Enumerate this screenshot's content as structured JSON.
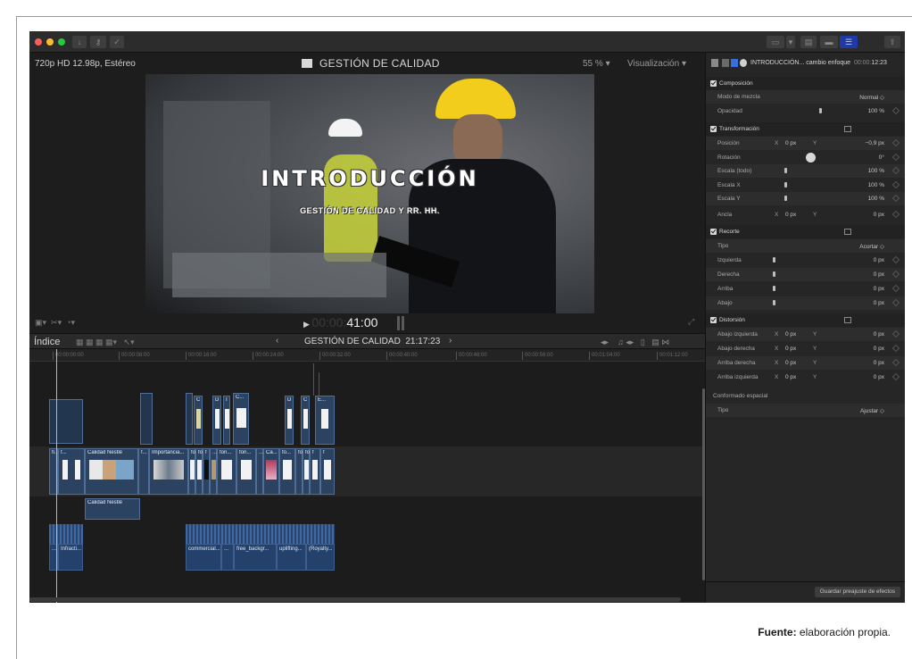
{
  "titlebar": {
    "icons": [
      "close-dot",
      "minimize-dot",
      "maximize-dot",
      "download-icon",
      "key-icon",
      "check-icon"
    ],
    "colors": {
      "close": "#ff5f57",
      "minimize": "#febc2e",
      "maximize": "#28c840"
    }
  },
  "viewer": {
    "format": "720p HD 12.98p, Estéreo",
    "title": "GESTIÓN DE CALIDAD",
    "zoom": "55 %",
    "view_menu": "Visualización",
    "video_title": "INTRODUCCIÓN",
    "video_subtitle": "GESTIÓN DE CALIDAD Y RR. HH.",
    "timecode_dim": "00:00:",
    "timecode": "41:00"
  },
  "timeline": {
    "index_label": "Índice",
    "project_title": "GESTIÓN DE CALIDAD",
    "project_duration": "21:17:23",
    "ruler_ticks": [
      "00:00:00:00",
      "00:00:08:00",
      "00:00:16:00",
      "00:00:24:00",
      "00:00:32:00",
      "00:00:40:00",
      "00:00:48:00",
      "00:00:56:00",
      "00:01:04:00",
      "00:01:12:00"
    ],
    "upper_clips": [
      "C",
      "D",
      "I",
      "C...",
      "D",
      "C",
      "E..."
    ],
    "story_clips": [
      "fi...",
      "f...",
      "Calidad Nestlé",
      "f...",
      "Importancia...",
      "fo",
      "fo",
      "f",
      "...",
      "fon...",
      "fon...",
      "...",
      "Ca...",
      "fo...",
      "fo",
      "fo",
      "f",
      "f"
    ],
    "connected_clip": "Calidad Nestlé",
    "audio_clips": [
      "...",
      "Infracti...",
      "commercial...",
      "...",
      "free_backgr...",
      "uplifting...",
      "(Royalty..."
    ]
  },
  "inspector": {
    "clip_name": "INTRODUCCIÓN... cambio enfoque",
    "clip_tc_dim": "00:00:",
    "clip_tc": "12:23",
    "sections": {
      "composicion": "Composición",
      "transformacion": "Transformación",
      "recorte": "Recorte",
      "distorsion": "Distorsión"
    },
    "rows": {
      "modo_mezcla": {
        "label": "Modo de mezcla",
        "value": "Normal ◇"
      },
      "opacidad": {
        "label": "Opacidad",
        "value": "100 %"
      },
      "posicion": {
        "label": "Posición",
        "x_label": "X",
        "x": "0 px",
        "y_label": "Y",
        "y": "−0,9 px"
      },
      "rotacion": {
        "label": "Rotación",
        "value": "0°"
      },
      "escala_todo": {
        "label": "Escala (todo)",
        "value": "100 %"
      },
      "escala_x": {
        "label": "Escala X",
        "value": "100 %"
      },
      "escala_y": {
        "label": "Escala Y",
        "value": "100 %"
      },
      "ancla": {
        "label": "Ancla",
        "x_label": "X",
        "x": "0 px",
        "y_label": "Y",
        "y": "0 px"
      },
      "tipo_recorte": {
        "label": "Tipo",
        "value": "Acortar ◇"
      },
      "izquierda": {
        "label": "Izquierda",
        "value": "0 px"
      },
      "derecha": {
        "label": "Derecha",
        "value": "0 px"
      },
      "arriba": {
        "label": "Arriba",
        "value": "0 px"
      },
      "abajo": {
        "label": "Abajo",
        "value": "0 px"
      },
      "abajo_izq": {
        "label": "Abajo izquierda",
        "x_label": "X",
        "x": "0 px",
        "y_label": "Y",
        "y": "0 px"
      },
      "abajo_der": {
        "label": "Abajo derecha",
        "x_label": "X",
        "x": "0 px",
        "y_label": "Y",
        "y": "0 px"
      },
      "arriba_der": {
        "label": "Arriba derecha",
        "x_label": "X",
        "x": "0 px",
        "y_label": "Y",
        "y": "0 px"
      },
      "arriba_izq": {
        "label": "Arriba izquierda",
        "x_label": "X",
        "x": "0 px",
        "y_label": "Y",
        "y": "0 px"
      }
    },
    "conformado": "Conformado espacial",
    "tipo_conformado": {
      "label": "Tipo",
      "value": "Ajustar ◇"
    },
    "save_button": "Guardar preajuste de efectos"
  },
  "caption": {
    "label": "Fuente:",
    "text": " elaboración propia."
  }
}
